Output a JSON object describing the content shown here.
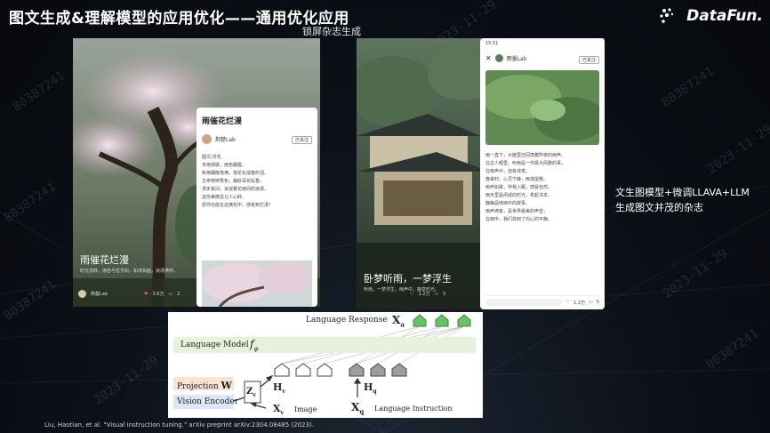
{
  "header": {
    "title": "图文生成&理解模型的应用优化——通用优化应用",
    "subtitle": "锁屏杂志生成",
    "logo_text": "DataFun."
  },
  "watermarks": [
    "2023-11-29",
    "80387241",
    "80387241",
    "2023-11-29",
    "80387241",
    "2023-11-29",
    "80387241",
    "2023-11-29",
    "80387241",
    "2023-11-29"
  ],
  "left_panel": {
    "cover_title": "雨催花烂漫",
    "cover_caption": "时光流转，雨色与花交织，如诗如画，浪漫满怀。",
    "author": "荆楚Lab",
    "stats": {
      "likes": "3.6万",
      "comments": "2"
    },
    "article": {
      "title": "雨催花烂漫",
      "author": "荆楚Lab",
      "follow": "已关注",
      "lines": [
        "图文/寻花",
        "冬雨渐歇，雨色朦胧。",
        "新雨碾散落满，落花化成春的泪。",
        "古亭娉婷秀色，静卧百花乱香。",
        "漫步其间，诉说着花雨间的浪漫。",
        "这份美丽总让人心醉。",
        "愿你也能在这满花中，感受到烂漫！"
      ]
    }
  },
  "right_panel": {
    "cover_title": "卧梦听雨，一梦浮生",
    "cover_caption": "听雨，一梦浮生，雨声中，静享时光。",
    "stats": {
      "likes": "1.2万",
      "comments": "5"
    },
    "article": {
      "time": "15:51",
      "author": "雨墨Lab",
      "follow": "已关注",
      "lines": [
        "雨一直下，大脑里还回荡着昨夜的雨声。",
        "在古人眼里，听雨是一件极为风雅的事，",
        "在雨声中，自有诗意。",
        "春来时，心灵宁静，雨落屋檐。",
        "雨声如歌，伴我入眠，感受自然。",
        "雨天里是闲适的时光，拿起书本，",
        "静静品味雨中的故事。",
        "雨声滴答，是世界最美的声音，",
        "在雨中，我们找到了内心的平静。"
      ],
      "stats": {
        "likes": "1.2万",
        "comments": "5"
      }
    }
  },
  "side_note": "文生图模型+微调LLAVA+LLM 生成图文并茂的杂志",
  "diagram": {
    "language_response": "Language Response",
    "xa": "X",
    "xa_sub": "a",
    "language_model": "Language Model",
    "f_phi": "f",
    "f_sub": "φ",
    "projection": "Projection",
    "w": "W",
    "vision_encoder": "Vision Encoder",
    "zv": "Z",
    "zv_sub": "v",
    "hv": "H",
    "hv_sub": "v",
    "hq": "H",
    "hq_sub": "q",
    "xv": "X",
    "xv_sub": "v",
    "image": "Image",
    "xq": "X",
    "xq_sub": "q",
    "language_instruction": "Language Instruction"
  },
  "citation": "Liu, Haotian, et al. \"Visual instruction tuning.\" arXiv preprint arXiv:2304.08485 (2023).",
  "colors": {
    "lm_band": "#e6f2dc",
    "projection": "#fbe2d3",
    "vision": "#dbe7f6",
    "token_green": "#6abf69",
    "token_gray": "#9e9e9e"
  }
}
